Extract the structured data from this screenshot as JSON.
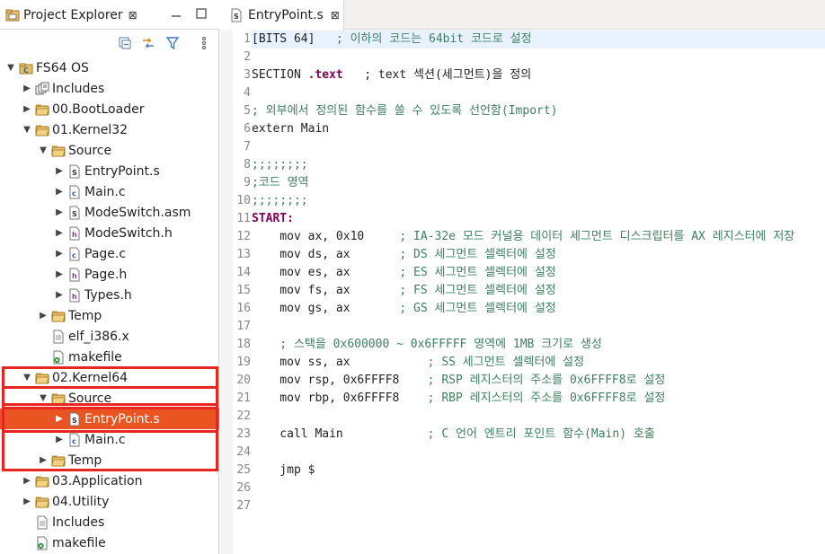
{
  "left_view": {
    "tab_label": "Project Explorer",
    "close_glyph": "⊠"
  },
  "tree": [
    {
      "label": "FS64 OS",
      "icon": "project-icon",
      "level": 0,
      "expanded": true
    },
    {
      "label": "Includes",
      "icon": "includes-icon",
      "level": 1,
      "expanded": false
    },
    {
      "label": "00.BootLoader",
      "icon": "folder-icon",
      "level": 1,
      "expanded": false
    },
    {
      "label": "01.Kernel32",
      "icon": "folder-icon",
      "level": 1,
      "expanded": true
    },
    {
      "label": "Source",
      "icon": "folder-icon",
      "level": 2,
      "expanded": true
    },
    {
      "label": "EntryPoint.s",
      "icon": "s-file-icon",
      "level": 3,
      "expanded": false
    },
    {
      "label": "Main.c",
      "icon": "c-file-icon",
      "level": 3,
      "expanded": false
    },
    {
      "label": "ModeSwitch.asm",
      "icon": "s-file-icon",
      "level": 3,
      "expanded": false
    },
    {
      "label": "ModeSwitch.h",
      "icon": "h-file-icon",
      "level": 3,
      "expanded": false
    },
    {
      "label": "Page.c",
      "icon": "c-file-icon",
      "level": 3,
      "expanded": false
    },
    {
      "label": "Page.h",
      "icon": "h-file-icon",
      "level": 3,
      "expanded": false
    },
    {
      "label": "Types.h",
      "icon": "h-file-icon",
      "level": 3,
      "expanded": false
    },
    {
      "label": "Temp",
      "icon": "folder-icon",
      "level": 2,
      "expanded": false
    },
    {
      "label": "elf_i386.x",
      "icon": "file-icon",
      "level": 2,
      "expanded": null
    },
    {
      "label": "makefile",
      "icon": "makefile-icon",
      "level": 2,
      "expanded": null
    },
    {
      "label": "02.Kernel64",
      "icon": "folder-icon",
      "level": 1,
      "expanded": true
    },
    {
      "label": "Source",
      "icon": "folder-icon",
      "level": 2,
      "expanded": true
    },
    {
      "label": "EntryPoint.s",
      "icon": "s-file-icon",
      "level": 3,
      "expanded": false,
      "selected": true
    },
    {
      "label": "Main.c",
      "icon": "c-file-icon",
      "level": 3,
      "expanded": false
    },
    {
      "label": "Temp",
      "icon": "folder-icon",
      "level": 2,
      "expanded": false
    },
    {
      "label": "03.Application",
      "icon": "folder-icon",
      "level": 1,
      "expanded": false
    },
    {
      "label": "04.Utility",
      "icon": "folder-icon",
      "level": 1,
      "expanded": false
    },
    {
      "label": "Includes",
      "icon": "file-icon",
      "level": 1,
      "expanded": null
    },
    {
      "label": "makefile",
      "icon": "makefile-icon",
      "level": 1,
      "expanded": null
    }
  ],
  "editor": {
    "tab_label": "EntryPoint.s",
    "close_glyph": "⊠",
    "line_numbers": [
      "1",
      "2",
      "3",
      "4",
      "5",
      "6",
      "7",
      "8",
      "9",
      "10",
      "11",
      "12",
      "13",
      "14",
      "15",
      "16",
      "17",
      "18",
      "19",
      "20",
      "21",
      "22",
      "23",
      "24",
      "25",
      "26",
      "27"
    ],
    "lines": [
      [
        {
          "t": "[BITS 64]   ",
          "c": ""
        },
        {
          "t": "; 이하의 코드는 64bit 코드로 설정",
          "c": "cmt"
        }
      ],
      [],
      [
        {
          "t": "SECTION ",
          "c": ""
        },
        {
          "t": ".text",
          "c": "kw"
        },
        {
          "t": "   ; text 섹션(세그먼트)을 정의",
          "c": ""
        }
      ],
      [],
      [
        {
          "t": "; 외부에서 정의된 함수를 쓸 수 있도록 선언함(Import)",
          "c": "cmt"
        }
      ],
      [
        {
          "t": "extern Main",
          "c": ""
        }
      ],
      [],
      [
        {
          "t": ";;;;;;;;",
          "c": "cmt"
        }
      ],
      [
        {
          "t": ";코드 영역",
          "c": "cmt"
        }
      ],
      [
        {
          "t": ";;;;;;;;",
          "c": "cmt"
        }
      ],
      [
        {
          "t": "START:",
          "c": "kw"
        }
      ],
      [
        {
          "t": "    mov ax, 0x10     ",
          "c": ""
        },
        {
          "t": "; IA-32e 모드 커널용 데이터 세그먼트 디스크립터를 AX 레지스터에 저장",
          "c": "cmt"
        }
      ],
      [
        {
          "t": "    mov ds, ax       ",
          "c": ""
        },
        {
          "t": "; DS 세그먼트 셀렉터에 설정",
          "c": "cmt"
        }
      ],
      [
        {
          "t": "    mov es, ax       ",
          "c": ""
        },
        {
          "t": "; ES 세그먼트 셀렉터에 설정",
          "c": "cmt"
        }
      ],
      [
        {
          "t": "    mov fs, ax       ",
          "c": ""
        },
        {
          "t": "; FS 세그먼트 셀렉터에 설정",
          "c": "cmt"
        }
      ],
      [
        {
          "t": "    mov gs, ax       ",
          "c": ""
        },
        {
          "t": "; GS 세그먼트 셀렉터에 설정",
          "c": "cmt"
        }
      ],
      [],
      [
        {
          "t": "    ; 스택을 0x600000 ~ 0x6FFFFF 영역에 1MB 크기로 생성",
          "c": "cmt"
        }
      ],
      [
        {
          "t": "    mov ss, ax           ",
          "c": ""
        },
        {
          "t": "; SS 세그먼트 셀렉터에 설정",
          "c": "cmt"
        }
      ],
      [
        {
          "t": "    mov rsp, 0x6FFFF8    ",
          "c": ""
        },
        {
          "t": "; RSP 레지스터의 주소를 0x6FFFF8로 설정",
          "c": "cmt"
        }
      ],
      [
        {
          "t": "    mov rbp, 0x6FFFF8    ",
          "c": ""
        },
        {
          "t": "; RBP 레지스터의 주소를 0x6FFFF8로 설정",
          "c": "cmt"
        }
      ],
      [],
      [
        {
          "t": "    call Main            ",
          "c": ""
        },
        {
          "t": "; C 언어 엔트리 포인트 함수(Main) 호출",
          "c": "cmt"
        }
      ],
      [],
      [
        {
          "t": "    jmp $",
          "c": ""
        }
      ],
      [],
      []
    ]
  },
  "colors": {
    "selection": "#e95420",
    "highlight_box": "#e8261f",
    "comment": "#3f7f5f",
    "keyword": "#7f0055",
    "folder": "#d9b44a"
  }
}
